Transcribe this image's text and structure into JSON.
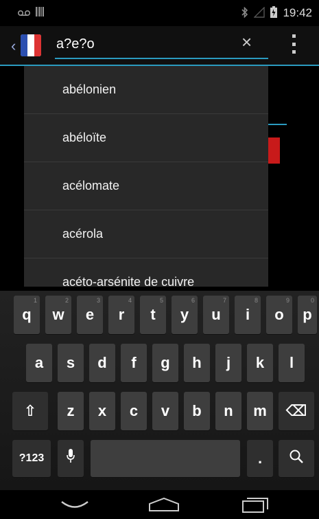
{
  "status_bar": {
    "time": "19:42",
    "icons": [
      "voicemail-icon",
      "barcode-icon",
      "bluetooth-icon",
      "signal-icon",
      "battery-icon"
    ]
  },
  "action_bar": {
    "search_value": "a?e?o",
    "clear_glyph": "×",
    "back_glyph": "‹"
  },
  "suggestions": [
    "abélonien",
    "abéloïte",
    "acélomate",
    "acérola",
    "acéto-arsénite de cuivre"
  ],
  "keyboard": {
    "row1": [
      {
        "label": "q",
        "hint": "1"
      },
      {
        "label": "w",
        "hint": "2"
      },
      {
        "label": "e",
        "hint": "3"
      },
      {
        "label": "r",
        "hint": "4"
      },
      {
        "label": "t",
        "hint": "5"
      },
      {
        "label": "y",
        "hint": "6"
      },
      {
        "label": "u",
        "hint": "7"
      },
      {
        "label": "i",
        "hint": "8"
      },
      {
        "label": "o",
        "hint": "9"
      },
      {
        "label": "p",
        "hint": "0"
      }
    ],
    "row2": [
      "a",
      "s",
      "d",
      "f",
      "g",
      "h",
      "j",
      "k",
      "l"
    ],
    "row3": [
      "z",
      "x",
      "c",
      "v",
      "b",
      "n",
      "m"
    ],
    "shift_glyph": "⇧",
    "delete_glyph": "⌫",
    "symbols_label": "?123",
    "mic_glyph": "🎙",
    "period_label": ".",
    "search_glyph": "⚲"
  },
  "nav_bar": {
    "back_glyph": "﹀",
    "home_glyph": "⌂",
    "recents_glyph": "▭"
  }
}
